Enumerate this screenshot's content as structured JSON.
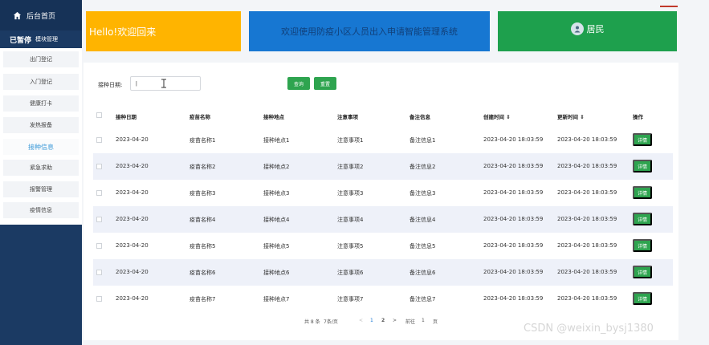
{
  "sidebar": {
    "home_label": "后台首页",
    "module_prefix": "已暂停",
    "module_label": "模块管理",
    "items": [
      {
        "label": "出门登记"
      },
      {
        "label": "入门登记"
      },
      {
        "label": "健康打卡"
      },
      {
        "label": "发热报备"
      },
      {
        "label": "接种信息",
        "active": true
      },
      {
        "label": "紧急求助"
      },
      {
        "label": "报警管理"
      },
      {
        "label": "疫情信息"
      }
    ]
  },
  "banners": {
    "welcome": "Hello!欢迎回来",
    "system": "欢迎使用防疫小区人员出入申请智能管理系统",
    "role": "居民"
  },
  "search": {
    "label": "接种日期:",
    "value": "|",
    "query_button": "查询",
    "reset_button": "重置"
  },
  "table": {
    "headers": [
      "接种日期",
      "疫苗名称",
      "接种地点",
      "注意事项",
      "备注信息",
      "创建时间 ⇕",
      "更新时间 ⇕",
      "操作"
    ],
    "detail_label": "详情",
    "rows": [
      [
        "2023-04-20",
        "疫苗名称1",
        "接种地点1",
        "注意事项1",
        "备注信息1",
        "2023-04-20 18:03:59",
        "2023-04-20 18:03:59"
      ],
      [
        "2023-04-20",
        "疫苗名称2",
        "接种地点2",
        "注意事项2",
        "备注信息2",
        "2023-04-20 18:03:59",
        "2023-04-20 18:03:59"
      ],
      [
        "2023-04-20",
        "疫苗名称3",
        "接种地点3",
        "注意事项3",
        "备注信息3",
        "2023-04-20 18:03:59",
        "2023-04-20 18:03:59"
      ],
      [
        "2023-04-20",
        "疫苗名称4",
        "接种地点4",
        "注意事项4",
        "备注信息4",
        "2023-04-20 18:03:59",
        "2023-04-20 18:03:59"
      ],
      [
        "2023-04-20",
        "疫苗名称5",
        "接种地点5",
        "注意事项5",
        "备注信息5",
        "2023-04-20 18:03:59",
        "2023-04-20 18:03:59"
      ],
      [
        "2023-04-20",
        "疫苗名称6",
        "接种地点6",
        "注意事项6",
        "备注信息6",
        "2023-04-20 18:03:59",
        "2023-04-20 18:03:59"
      ],
      [
        "2023-04-20",
        "疫苗名称7",
        "接种地点7",
        "注意事项7",
        "备注信息7",
        "2023-04-20 18:03:59",
        "2023-04-20 18:03:59"
      ]
    ]
  },
  "pager": {
    "total": "共 8 条",
    "page_size": "7条/页",
    "prev": "<",
    "page1": "1",
    "page2": "2",
    "next": ">",
    "goto_label": "前往",
    "goto_value": "1",
    "page_suffix": "页"
  },
  "watermark": "CSDN @weixin_bysj1380",
  "colors": {
    "sidebar": "#1b3a63",
    "welcome": "#ffb400",
    "system": "#1777d2",
    "role": "#1ea04d",
    "button": "#2ea44f"
  }
}
